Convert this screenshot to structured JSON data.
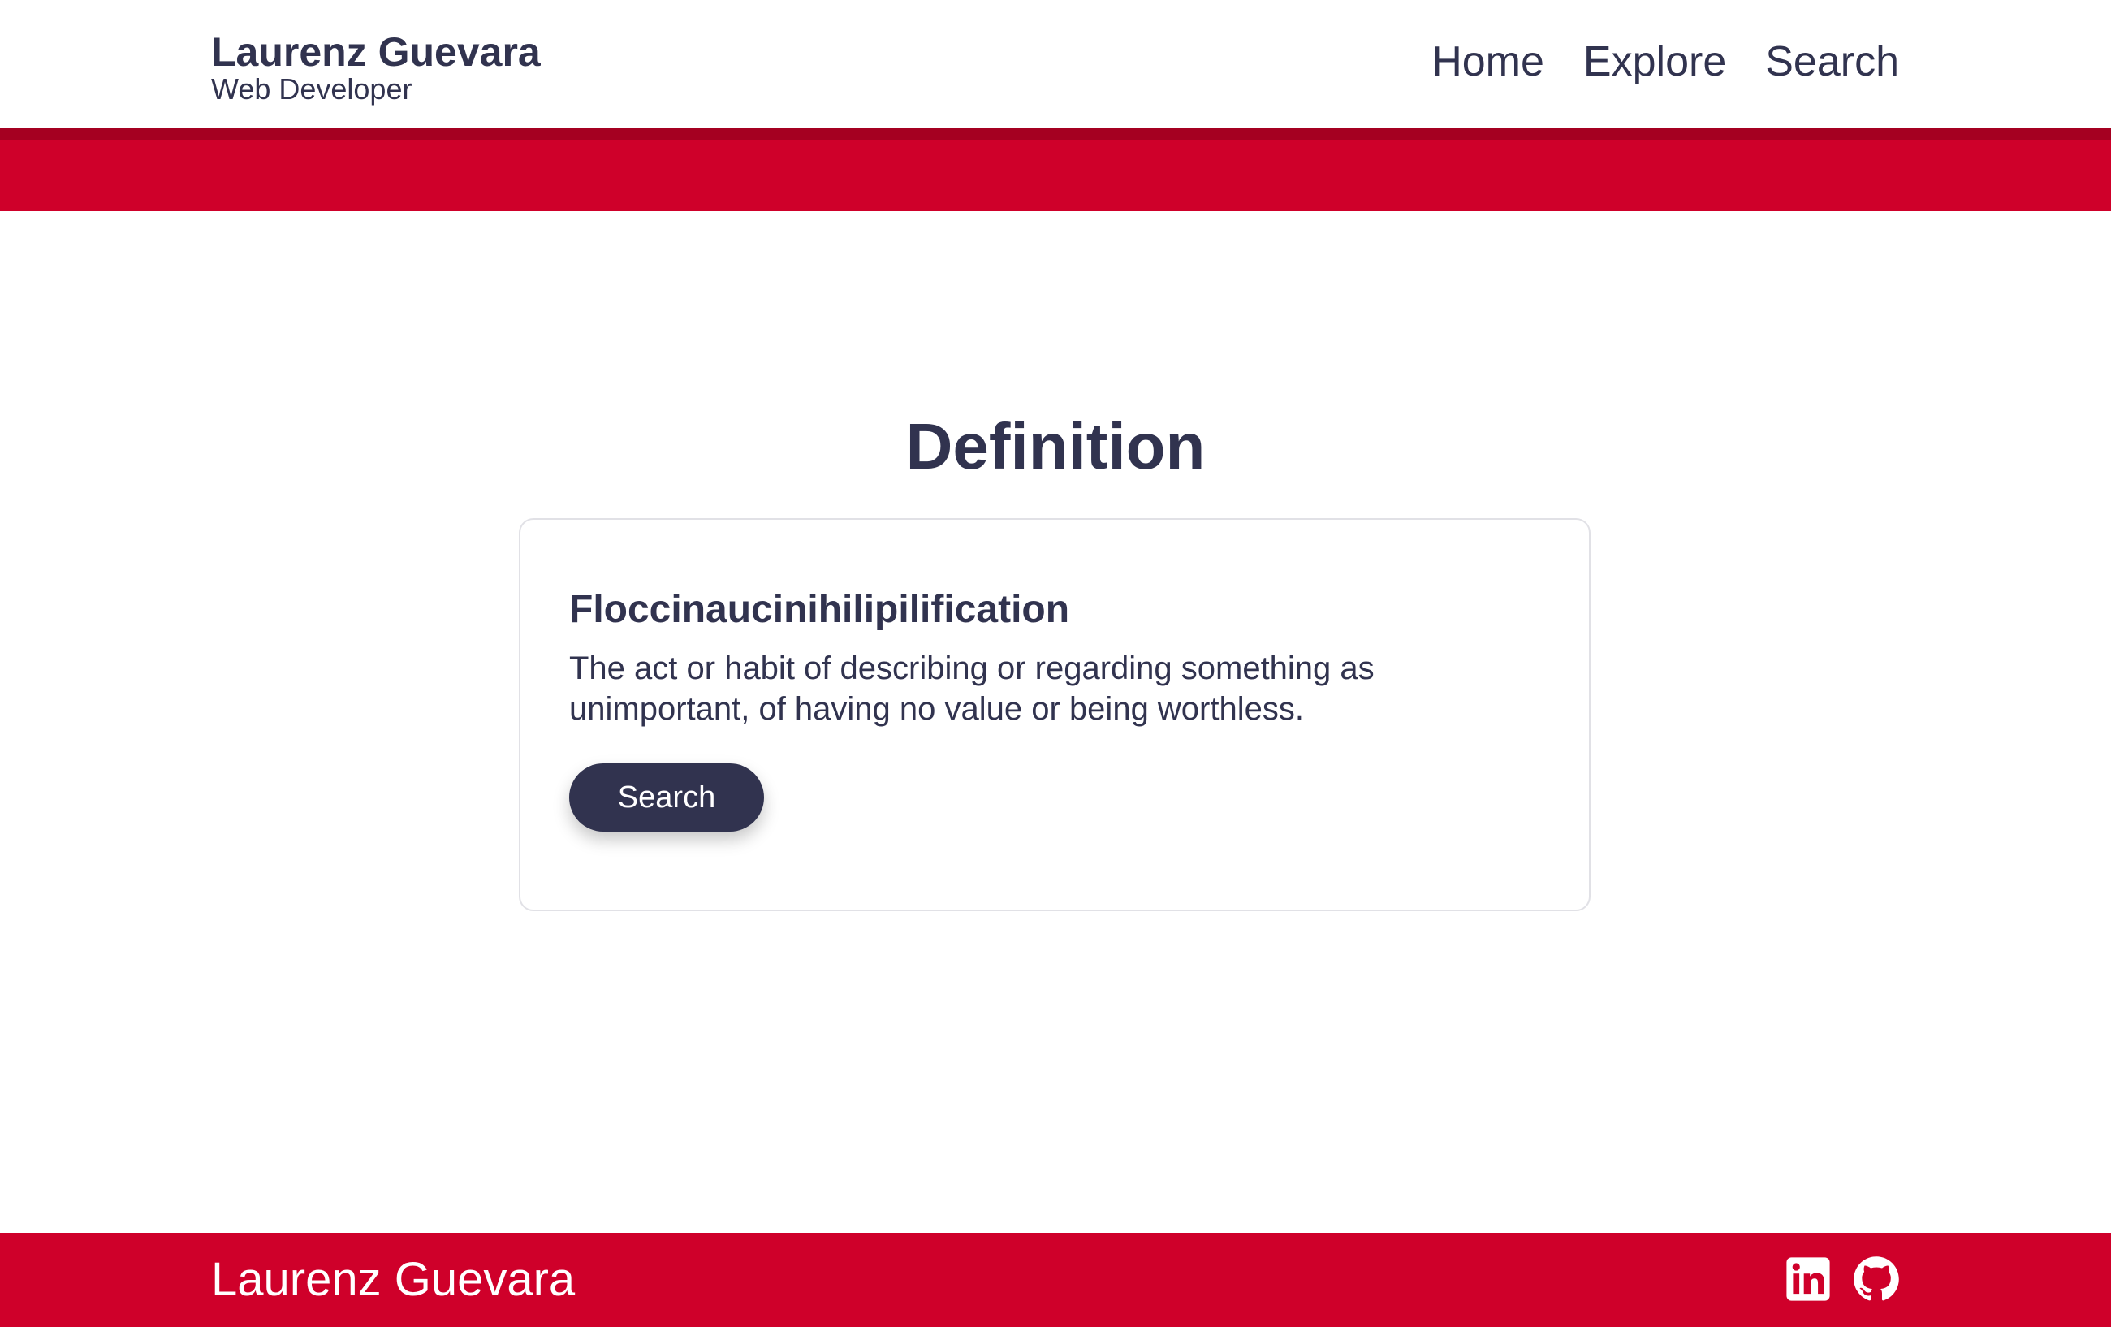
{
  "header": {
    "name": "Laurenz Guevara",
    "role": "Web Developer",
    "nav": [
      {
        "label": "Home"
      },
      {
        "label": "Explore"
      },
      {
        "label": "Search"
      }
    ]
  },
  "main": {
    "title": "Definition",
    "card": {
      "word": "Floccinaucinihilipilification",
      "definition": "The act or habit of describing or regarding something as unimportant, of having no value or being worthless.",
      "button_label": "Search"
    }
  },
  "footer": {
    "name": "Laurenz Guevara",
    "social": [
      "linkedin-icon",
      "github-icon"
    ]
  },
  "colors": {
    "accent_red": "#cf002a",
    "accent_red_dark": "#a50021",
    "text_navy": "#31334f",
    "card_border": "#e1e1e6"
  }
}
